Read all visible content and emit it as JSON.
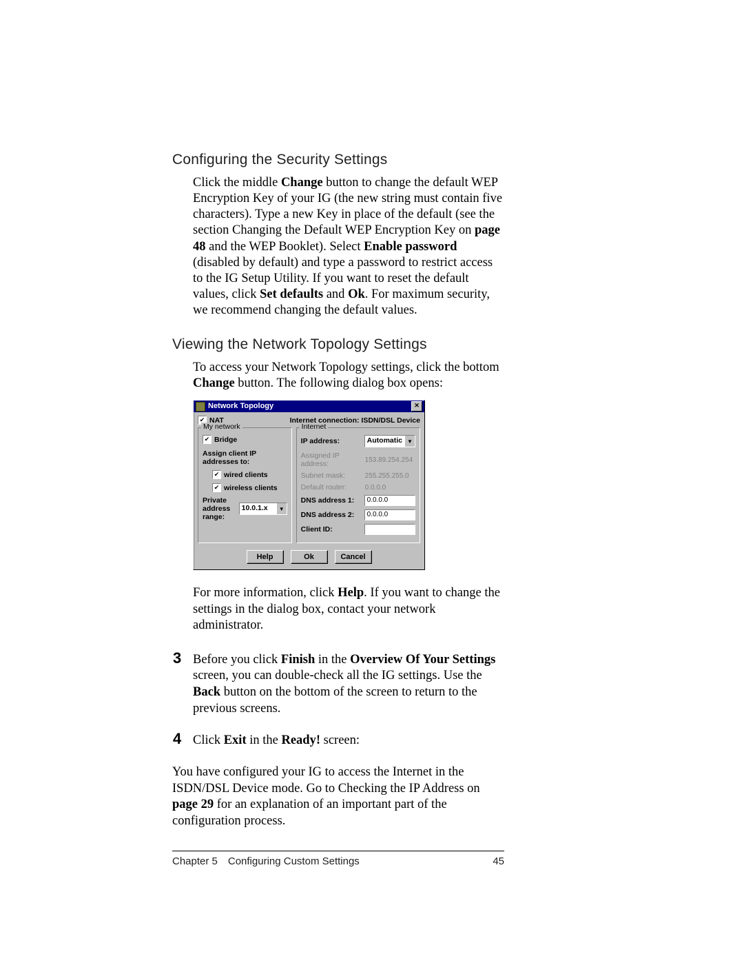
{
  "section1": {
    "heading": "Configuring the Security Settings",
    "p_pre": "Click the middle ",
    "p_change": "Change",
    "p_a": " button to change the default WEP Encryption Key of your IG (the new string must contain five characters). Type a new Key in place of the default (see the section Changing the Default WEP Encryption Key on ",
    "p_page48": "page 48",
    "p_b": " and the WEP Booklet). Select ",
    "p_enable": "Enable password",
    "p_c": " (disabled by default) and type a password to restrict access to the IG Setup Utility. If you want to reset the default values, click ",
    "p_setdef": "Set defaults",
    "p_d": " and ",
    "p_ok": "Ok",
    "p_e": ". For maximum security, we recommend changing the default values."
  },
  "section2": {
    "heading": "Viewing the Network Topology Settings",
    "intro_a": "To access your Network Topology settings, click the bottom ",
    "intro_change": "Change",
    "intro_b": " button. The following dialog box opens:"
  },
  "dialog": {
    "title": "Network Topology",
    "nat_label": "NAT",
    "conn_label": "Internet connection: ISDN/DSL Device",
    "mynetwork": "My network",
    "bridge_label": "Bridge",
    "assign_label": "Assign client IP addresses to:",
    "wired_label": "wired clients",
    "wireless_label": "wireless clients",
    "range_label": "Private address range:",
    "range_value": "10.0.1.x",
    "internet_title": "Internet",
    "ip_label": "IP address:",
    "ip_value": "Automatic",
    "assigned_ip_label": "Assigned IP address:",
    "assigned_ip_value": "153.89.254.254",
    "subnet_label": "Subnet mask:",
    "subnet_value": "255.255.255.0",
    "router_label": "Default router:",
    "router_value": "0.0.0.0",
    "dns1_label": "DNS address 1:",
    "dns1_value": "0.0.0.0",
    "dns2_label": "DNS address 2:",
    "dns2_value": "0.0.0.0",
    "clientid_label": "Client ID:",
    "clientid_value": "",
    "btn_help": "Help",
    "btn_ok": "Ok",
    "btn_cancel": "Cancel"
  },
  "after_dialog": {
    "a": "For more information, click ",
    "help": "Help",
    "b": ". If you want to change the settings in the dialog box, contact your network administrator."
  },
  "step3": {
    "num": "3",
    "a": "Before you click ",
    "finish": "Finish",
    "b": " in the ",
    "overview": "Overview Of Your Settings",
    "c": " screen, you can double-check all the IG settings. Use the ",
    "back": "Back",
    "d": " button on the bottom of the screen to return to the previous screens."
  },
  "step4": {
    "num": "4",
    "a": "Click ",
    "exit": "Exit",
    "b": " in the ",
    "ready": "Ready!",
    "c": " screen:"
  },
  "closing": {
    "a": "You have configured your IG to access the Internet in the ISDN/DSL Device mode. Go to Checking the IP Address on ",
    "page29": "page 29",
    "b": " for an explanation of an important part of the configuration process."
  },
  "footer": {
    "left": "Chapter 5 Configuring Custom Settings",
    "right": "45"
  }
}
